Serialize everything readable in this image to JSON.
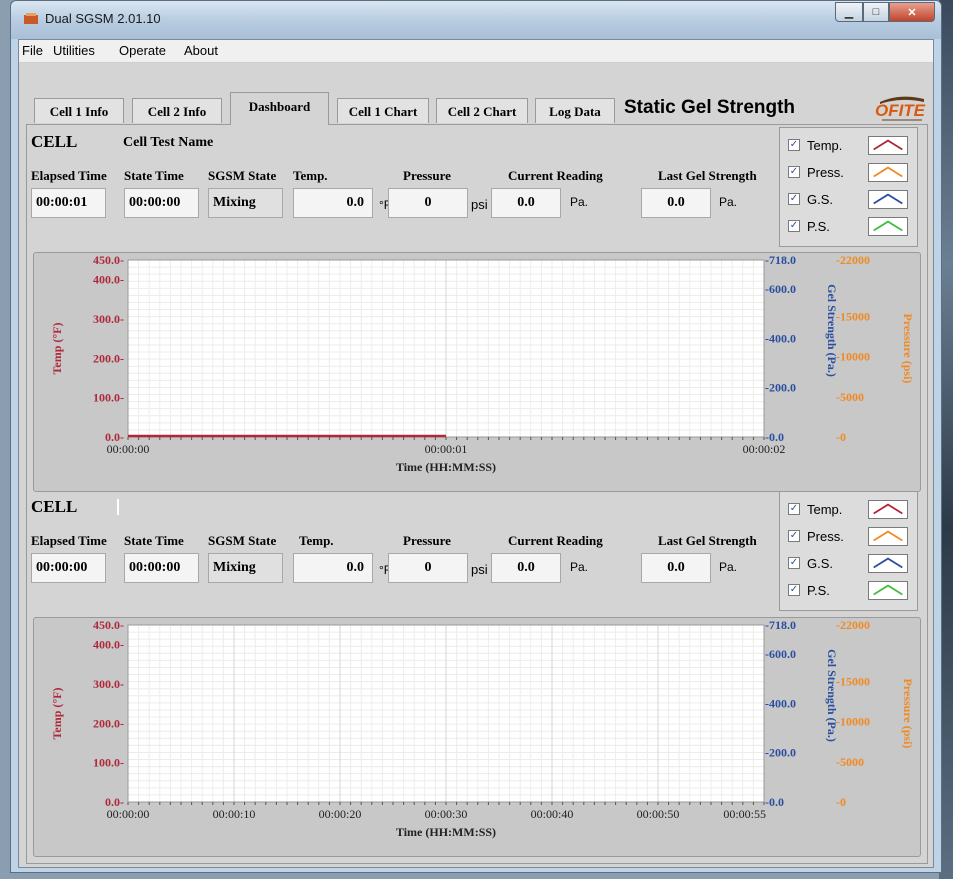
{
  "window": {
    "title": "Dual SGSM 2.01.10"
  },
  "menu": [
    "File",
    "Utilities",
    "Operate",
    "About"
  ],
  "tabs": [
    "Cell 1 Info",
    "Cell 2 Info",
    "Dashboard",
    "Cell 1 Chart",
    "Cell 2 Chart",
    "Log Data"
  ],
  "active_tab": "Dashboard",
  "header": {
    "title": "Static Gel Strength",
    "logo_text": "OFITE"
  },
  "labels": {
    "elapsed": "Elapsed Time",
    "state_time": "State Time",
    "state": "SGSM State",
    "temp": "Temp.",
    "pressure": "Pressure",
    "current": "Current Reading",
    "last_gel": "Last Gel Strength",
    "unit_f": "°F",
    "unit_psi": "psi",
    "unit_pa": "Pa."
  },
  "legend": [
    {
      "label": "Temp.",
      "color": "#b0283a",
      "checked": "✓"
    },
    {
      "label": "Press.",
      "color": "#f08a24",
      "checked": "✓"
    },
    {
      "label": "G.S.",
      "color": "#2a4ea0",
      "checked": "✓"
    },
    {
      "label": "P.S.",
      "color": "#3fbf3f",
      "checked": "✓"
    }
  ],
  "cell1": {
    "heading": "CELL",
    "test_name": "Cell Test Name",
    "elapsed": "00:00:01",
    "state_time": "00:00:00",
    "state": "Mixing",
    "temp": "0.0",
    "pressure": "0",
    "current": "0.0",
    "last_gel": "0.0"
  },
  "cell2": {
    "heading": "CELL",
    "test_name": "",
    "elapsed": "00:00:00",
    "state_time": "00:00:00",
    "state": "Mixing",
    "temp": "0.0",
    "pressure": "0",
    "current": "0.0",
    "last_gel": "0.0"
  },
  "chart_data": [
    {
      "type": "line",
      "xlabel": "Time (HH:MM:SS)",
      "x_ticks": [
        "00:00:00",
        "00:00:01",
        "00:00:02"
      ],
      "temp_axis": {
        "label": "Temp (°F)",
        "ticks": [
          "450.0",
          "400.0",
          "300.0",
          "200.0",
          "100.0",
          "0.0"
        ],
        "ylim": [
          0,
          450
        ],
        "color": "#b0283a"
      },
      "gel_axis": {
        "label": "Gel Strength (Pa.)",
        "ticks": [
          "718.0",
          "600.0",
          "400.0",
          "200.0",
          "0.0"
        ],
        "ylim": [
          0,
          718
        ],
        "color": "#2a4ea0"
      },
      "pressure_axis": {
        "label": "Pressure (psi)",
        "ticks": [
          "22000",
          "15000",
          "10000",
          "5000",
          "0"
        ],
        "ylim": [
          0,
          22000
        ],
        "color": "#f08a24"
      },
      "series": [
        {
          "name": "Temp.",
          "x": [
            0,
            1
          ],
          "y": [
            0,
            0
          ]
        }
      ]
    },
    {
      "type": "line",
      "xlabel": "Time (HH:MM:SS)",
      "x_ticks": [
        "00:00:00",
        "00:00:10",
        "00:00:20",
        "00:00:30",
        "00:00:40",
        "00:00:50",
        "00:00:55"
      ],
      "temp_axis": {
        "label": "Temp (°F)",
        "ticks": [
          "450.0",
          "400.0",
          "300.0",
          "200.0",
          "100.0",
          "0.0"
        ],
        "ylim": [
          0,
          450
        ],
        "color": "#b0283a"
      },
      "gel_axis": {
        "label": "Gel Strength (Pa.)",
        "ticks": [
          "718.0",
          "600.0",
          "400.0",
          "200.0",
          "0.0"
        ],
        "ylim": [
          0,
          718
        ],
        "color": "#2a4ea0"
      },
      "pressure_axis": {
        "label": "Pressure (psi)",
        "ticks": [
          "22000",
          "15000",
          "10000",
          "5000",
          "0"
        ],
        "ylim": [
          0,
          22000
        ],
        "color": "#f08a24"
      },
      "series": []
    }
  ]
}
